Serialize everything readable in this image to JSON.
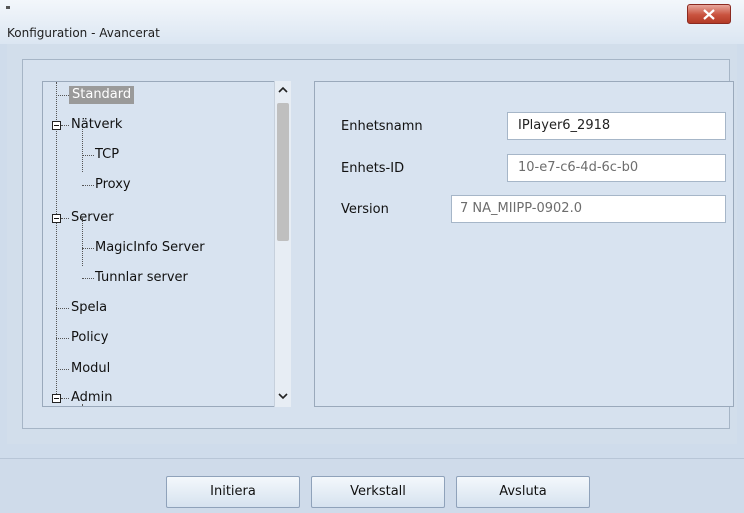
{
  "window": {
    "title": "Konfiguration - Avancerat"
  },
  "tree": {
    "items": [
      {
        "label": "Standard",
        "selected": true
      },
      {
        "label": "Nätverk",
        "expandable": true
      },
      {
        "label": "TCP"
      },
      {
        "label": "Proxy"
      },
      {
        "label": "Server",
        "expandable": true
      },
      {
        "label": "MagicInfo Server"
      },
      {
        "label": "Tunnlar server"
      },
      {
        "label": "Spela"
      },
      {
        "label": "Policy"
      },
      {
        "label": "Modul"
      },
      {
        "label": "Admin",
        "expandable": true
      }
    ],
    "scroll_up_icon": "chevron-up-icon",
    "scroll_down_icon": "chevron-down-icon"
  },
  "details": {
    "fields": [
      {
        "label": "Enhetsnamn",
        "value": "IPlayer6_2918"
      },
      {
        "label": "Enhets-ID",
        "value": "10-e7-c6-4d-6c-b0"
      },
      {
        "label": "Version",
        "value": "7 NA_MIIPP-0902.0"
      }
    ]
  },
  "buttons": {
    "initiate": "Initiera",
    "apply": "Verkstall",
    "exit": "Avsluta"
  },
  "colors": {
    "close_button": "#c9533f",
    "background": "#cfdceb",
    "selection": "#9a9a9a"
  }
}
